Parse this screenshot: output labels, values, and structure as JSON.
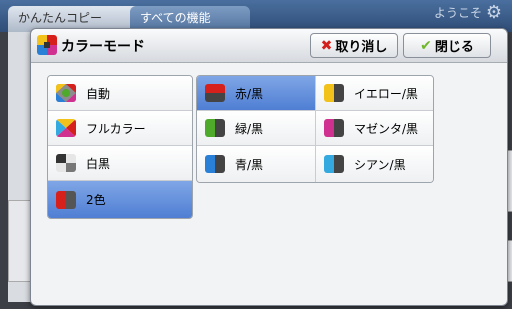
{
  "background": {
    "tab1_label": "かんたんコピー",
    "tab2_label": "すべての機能",
    "user_label": "ようこそ"
  },
  "dialog": {
    "title": "カラーモード",
    "cancel_label": "取り消し",
    "close_label": "閉じる"
  },
  "left_options": [
    {
      "label": "自動",
      "icon": "auto-color-icon",
      "selected": false
    },
    {
      "label": "フルカラー",
      "icon": "full-color-icon",
      "selected": false
    },
    {
      "label": "白黒",
      "icon": "black-white-icon",
      "selected": false
    },
    {
      "label": "2色",
      "icon": "two-color-icon",
      "selected": true
    }
  ],
  "right_options": [
    {
      "label": "赤/黒",
      "icon": "red-black-icon",
      "selected": true
    },
    {
      "label": "イエロー/黒",
      "icon": "yellow-black-icon",
      "selected": false
    },
    {
      "label": "緑/黒",
      "icon": "green-black-icon",
      "selected": false
    },
    {
      "label": "マゼンタ/黒",
      "icon": "magenta-black-icon",
      "selected": false
    },
    {
      "label": "青/黒",
      "icon": "blue-black-icon",
      "selected": false
    },
    {
      "label": "シアン/黒",
      "icon": "cyan-black-icon",
      "selected": false
    }
  ],
  "colors": {
    "selected_bg": "#5b86d6",
    "red": "#d6201c",
    "yellow": "#f2c21a",
    "green": "#4fa92b",
    "magenta": "#d0308f",
    "blue": "#2a7fd6",
    "cyan": "#33a9df"
  }
}
